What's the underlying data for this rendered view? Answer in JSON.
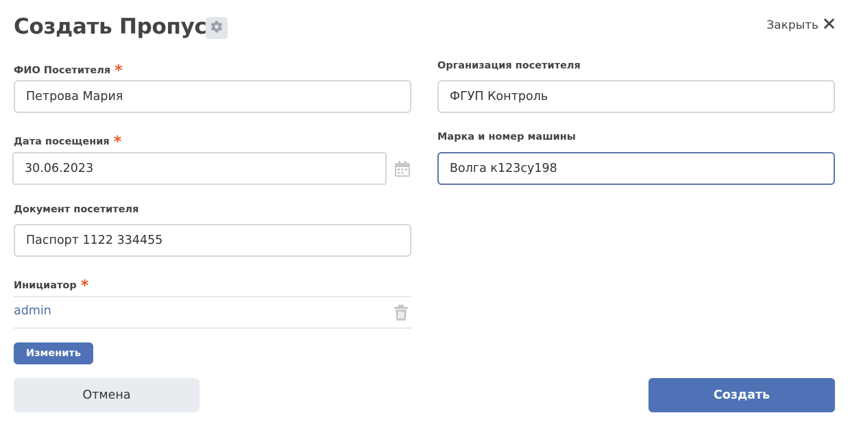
{
  "header": {
    "title": "Создать Пропуск",
    "settings_icon": "gear-icon",
    "close_label": "Закрыть",
    "close_icon": "close-icon"
  },
  "form": {
    "required_marker": "*",
    "fio": {
      "label": "ФИО Посетителя",
      "value": "Петрова Мария",
      "required": true
    },
    "organization": {
      "label": "Организация посетителя",
      "value": "ФГУП Контроль",
      "required": false
    },
    "visit_date": {
      "label": "Дата посещения",
      "value": "30.06.2023",
      "required": true,
      "icon": "calendar-icon"
    },
    "car": {
      "label": "Марка и номер машины",
      "value": "Волга к123су198",
      "required": false
    },
    "document": {
      "label": "Документ посетителя",
      "value": "Паспорт 1122 334455",
      "required": false
    },
    "initiator": {
      "label": "Инициатор",
      "value": "admin",
      "required": true,
      "delete_icon": "trash-icon"
    },
    "change_button": "Изменить"
  },
  "footer": {
    "cancel_label": "Отмена",
    "create_label": "Создать"
  },
  "colors": {
    "accent": "#4e72b5",
    "required": "#e8582e",
    "focus_border": "#5b76a8",
    "border": "#d4d7db",
    "link": "#4b6fa8"
  }
}
